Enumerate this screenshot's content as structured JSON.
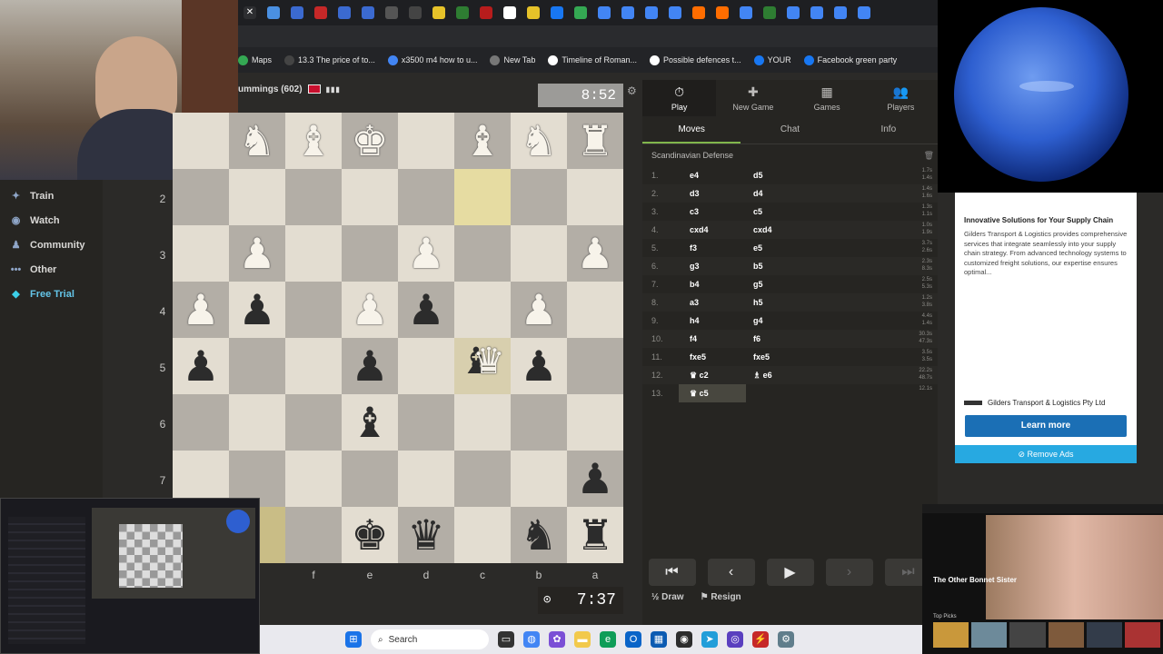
{
  "bookmarks": [
    {
      "label": "Maps",
      "color": "#34a853"
    },
    {
      "label": "13.3 The price of to...",
      "color": "#444"
    },
    {
      "label": "x3500 m4 how to u...",
      "color": "#4285f4"
    },
    {
      "label": "New Tab",
      "color": "#777"
    },
    {
      "label": "Timeline of Roman...",
      "color": "#fff"
    },
    {
      "label": "Possible defences t...",
      "color": "#fff"
    },
    {
      "label": "YOUR",
      "color": "#1877f2"
    },
    {
      "label": "Facebook green party",
      "color": "#1877f2"
    }
  ],
  "leftnav": [
    {
      "label": "Train",
      "icon": "train-icon",
      "glyph": "✦"
    },
    {
      "label": "Watch",
      "icon": "watch-icon",
      "glyph": "◉"
    },
    {
      "label": "Community",
      "icon": "community-icon",
      "glyph": "♟"
    },
    {
      "label": "Other",
      "icon": "more-icon",
      "glyph": "•••"
    },
    {
      "label": "Free Trial",
      "icon": "diamond-icon",
      "glyph": "◆"
    }
  ],
  "top_player": {
    "name": "ummings (602)",
    "flag": "flag-icon"
  },
  "top_clock": "8:52",
  "bottom_clock": "7:37",
  "ranks": [
    "2",
    "3",
    "4",
    "5",
    "6",
    "7"
  ],
  "files": [
    "f",
    "e",
    "d",
    "c",
    "b",
    "a"
  ],
  "board": [
    [
      "",
      "♞w",
      "♝w",
      "♚w",
      "",
      "♝w",
      "♞w",
      "♜w"
    ],
    [
      "",
      "",
      "",
      "",
      "",
      "HL",
      "",
      ""
    ],
    [
      "",
      "♟w",
      "",
      "",
      "♟w",
      "",
      "",
      "♟w"
    ],
    [
      "♟w",
      "♟b",
      "",
      "♟w",
      "♟b",
      "",
      "♟w",
      ""
    ],
    [
      "♟b",
      "",
      "",
      "♟b",
      "",
      "♝b♛w",
      "♟b",
      ""
    ],
    [
      "",
      "",
      "",
      "♝b",
      "",
      "",
      "",
      ""
    ],
    [
      "",
      "",
      "",
      "",
      "",
      "",
      "",
      "♟b"
    ],
    [
      "♜b",
      "HL2",
      "",
      "♚b",
      "♛b",
      "",
      "♞b",
      "♜b"
    ]
  ],
  "panel": {
    "tabs": [
      {
        "label": "Play",
        "glyph": "⏱",
        "icon": "stopwatch-icon"
      },
      {
        "label": "New Game",
        "glyph": "✚",
        "icon": "plus-icon"
      },
      {
        "label": "Games",
        "glyph": "▦",
        "icon": "games-icon"
      },
      {
        "label": "Players",
        "glyph": "👥",
        "icon": "players-icon"
      }
    ],
    "subtabs": [
      "Moves",
      "Chat",
      "Info"
    ],
    "opening": "Scandinavian Defense",
    "moves": [
      {
        "n": "1.",
        "w": "e4",
        "b": "d5",
        "t": "1.7s\n1.4s"
      },
      {
        "n": "2.",
        "w": "d3",
        "b": "d4",
        "t": "1.4s\n1.6s"
      },
      {
        "n": "3.",
        "w": "c3",
        "b": "c5",
        "t": "1.3s\n1.1s"
      },
      {
        "n": "4.",
        "w": "cxd4",
        "b": "cxd4",
        "t": "1.0s\n1.9s"
      },
      {
        "n": "5.",
        "w": "f3",
        "b": "e5",
        "t": "3.7s\n2.6s"
      },
      {
        "n": "6.",
        "w": "g3",
        "b": "b5",
        "t": "2.3s\n8.3s"
      },
      {
        "n": "7.",
        "w": "b4",
        "b": "g5",
        "t": "2.5s\n5.3s"
      },
      {
        "n": "8.",
        "w": "a3",
        "b": "h5",
        "t": "1.2s\n3.8s"
      },
      {
        "n": "9.",
        "w": "h4",
        "b": "g4",
        "t": "4.4s\n1.4s"
      },
      {
        "n": "10.",
        "w": "f4",
        "b": "f6",
        "t": "30.3s\n47.3s"
      },
      {
        "n": "11.",
        "w": "fxe5",
        "b": "fxe5",
        "t": "3.5s\n3.5s"
      },
      {
        "n": "12.",
        "w": "♛ c2",
        "b": "♗ e6",
        "t": "22.2s\n48.7s"
      },
      {
        "n": "13.",
        "w": "♛ c5",
        "b": "",
        "t": "12.1s"
      }
    ],
    "draw": "Draw",
    "resign": "Resign",
    "nav": [
      "⏮",
      "‹",
      "▶",
      "›",
      "⏭"
    ]
  },
  "ad": {
    "headline": "Innovative Solutions for Your Supply Chain",
    "body": "Gilders Transport & Logistics provides comprehensive services that integrate seamlessly into your supply chain strategy. From advanced technology systems to customized freight solutions, our expertise ensures optimal...",
    "company": "Gilders Transport & Logistics Pty Ltd",
    "cta": "Learn more",
    "remove": "Remove Ads"
  },
  "tv": {
    "title": "The Other Bonnet Sister",
    "section": "Top Picks"
  },
  "taskbar": {
    "search": "Search"
  }
}
